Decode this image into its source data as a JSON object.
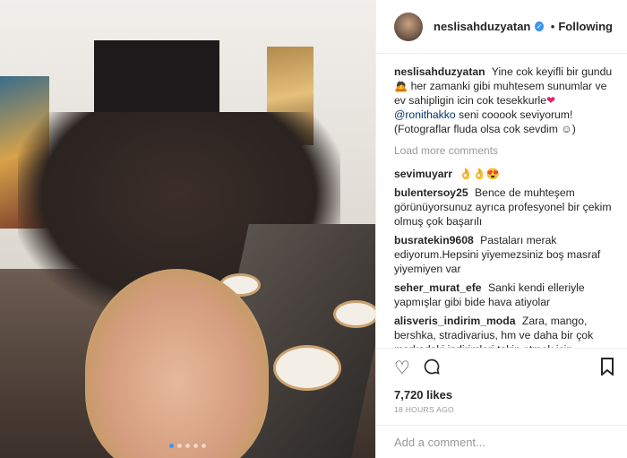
{
  "post": {
    "username": "neslisahduzyatan",
    "follow_label": "Following",
    "caption": {
      "user": "neslisahduzyatan",
      "line1": "Yine cok keyifli bir gundu",
      "line2": "her zamanki gibi muhtesem sunumlar ve ev sahipligin icin cok tesekkurle",
      "mention": "@ronithakko",
      "line3": "seni cooook seviyorum! (Fotograflar fluda olsa cok sevdim",
      "line3_end": ")"
    },
    "load_more": "Load more comments",
    "comments": [
      {
        "user": "sevimuyarr",
        "text": "👌👌😍"
      },
      {
        "user": "bulentersoy25",
        "text": "Bence de muhteşem görünüyorsunuz ayrıca profesyonel bir çekim olmuş çok başarılı"
      },
      {
        "user": "busratekin9608",
        "text": "Pastaları merak ediyorum.Hepsini yiyemezsiniz boş masraf yiyemiyen var"
      },
      {
        "user": "seher_murat_efe",
        "text": "Sanki kendi elleriyle yapmışlar gibi bide hava atiyolar"
      },
      {
        "user": "alisveris_indirim_moda",
        "text": "Zara, mango, bershka, stradivarius, hm ve daha bir çok markadaki indirimleri takip etmek için"
      }
    ],
    "likes": "7,720 likes",
    "time": "18 HOURS AGO",
    "add_comment_placeholder": "Add a comment...",
    "icons": {
      "verified": "verified-badge-icon",
      "like": "heart-icon",
      "comment": "comment-bubble-icon",
      "save": "bookmark-icon"
    },
    "colors": {
      "accent": "#3897f0",
      "mention": "#003569",
      "muted": "#999999"
    }
  }
}
